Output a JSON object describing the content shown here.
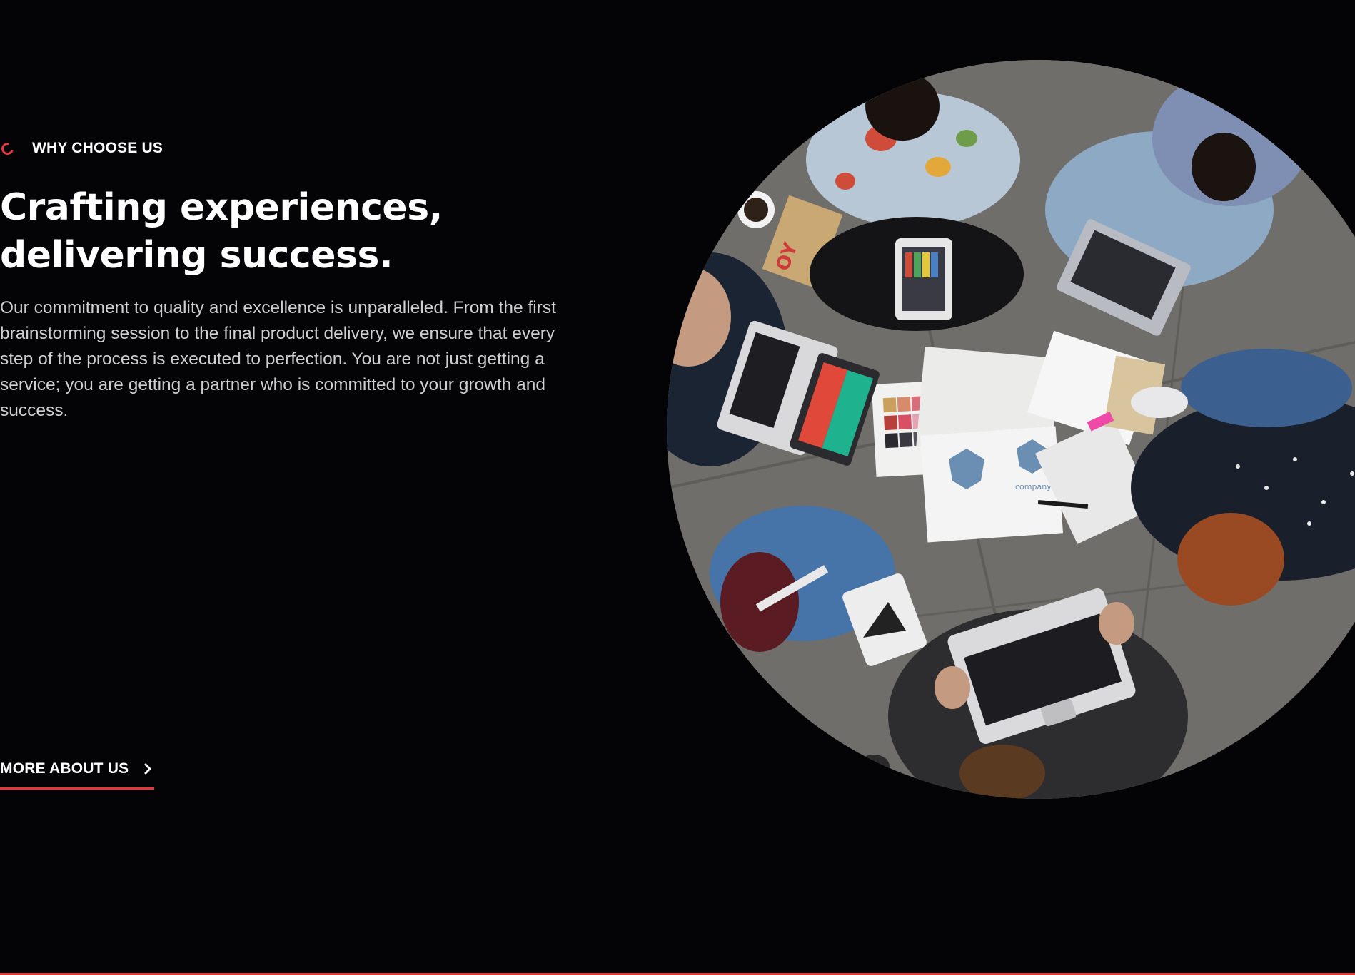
{
  "section": {
    "eyebrow": "WHY CHOOSE US",
    "headline_line1": "Crafting experiences,",
    "headline_line2": "delivering success.",
    "body_line1": "Our commitment to quality and excellence is unparalleled. From the first",
    "body_line2": "brainstorming session to the final product delivery, we ensure that every",
    "body_line3": "step of the process is executed to perfection. You are not just getting a",
    "body_line4": "service; you are getting a partner who is committed to your growth and",
    "body_line5": "success.",
    "cta_label": "MORE ABOUT US",
    "cta_icon": "chevron-right-icon",
    "photo_text_package": "OY",
    "photo_text_card": "company"
  },
  "colors": {
    "background": "#040406",
    "accent": "#e23a3a",
    "text_primary": "#ffffff",
    "text_secondary": "#cfcfd2"
  }
}
